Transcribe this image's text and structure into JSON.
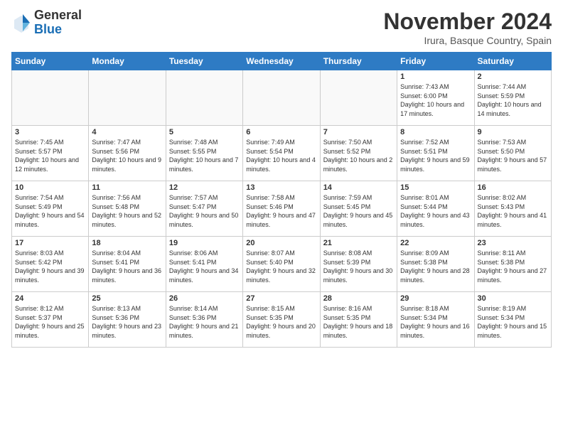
{
  "header": {
    "logo_general": "General",
    "logo_blue": "Blue",
    "month_title": "November 2024",
    "location": "Irura, Basque Country, Spain"
  },
  "days_of_week": [
    "Sunday",
    "Monday",
    "Tuesday",
    "Wednesday",
    "Thursday",
    "Friday",
    "Saturday"
  ],
  "weeks": [
    [
      {
        "day": "",
        "info": ""
      },
      {
        "day": "",
        "info": ""
      },
      {
        "day": "",
        "info": ""
      },
      {
        "day": "",
        "info": ""
      },
      {
        "day": "",
        "info": ""
      },
      {
        "day": "1",
        "info": "Sunrise: 7:43 AM\nSunset: 6:00 PM\nDaylight: 10 hours and 17 minutes."
      },
      {
        "day": "2",
        "info": "Sunrise: 7:44 AM\nSunset: 5:59 PM\nDaylight: 10 hours and 14 minutes."
      }
    ],
    [
      {
        "day": "3",
        "info": "Sunrise: 7:45 AM\nSunset: 5:57 PM\nDaylight: 10 hours and 12 minutes."
      },
      {
        "day": "4",
        "info": "Sunrise: 7:47 AM\nSunset: 5:56 PM\nDaylight: 10 hours and 9 minutes."
      },
      {
        "day": "5",
        "info": "Sunrise: 7:48 AM\nSunset: 5:55 PM\nDaylight: 10 hours and 7 minutes."
      },
      {
        "day": "6",
        "info": "Sunrise: 7:49 AM\nSunset: 5:54 PM\nDaylight: 10 hours and 4 minutes."
      },
      {
        "day": "7",
        "info": "Sunrise: 7:50 AM\nSunset: 5:52 PM\nDaylight: 10 hours and 2 minutes."
      },
      {
        "day": "8",
        "info": "Sunrise: 7:52 AM\nSunset: 5:51 PM\nDaylight: 9 hours and 59 minutes."
      },
      {
        "day": "9",
        "info": "Sunrise: 7:53 AM\nSunset: 5:50 PM\nDaylight: 9 hours and 57 minutes."
      }
    ],
    [
      {
        "day": "10",
        "info": "Sunrise: 7:54 AM\nSunset: 5:49 PM\nDaylight: 9 hours and 54 minutes."
      },
      {
        "day": "11",
        "info": "Sunrise: 7:56 AM\nSunset: 5:48 PM\nDaylight: 9 hours and 52 minutes."
      },
      {
        "day": "12",
        "info": "Sunrise: 7:57 AM\nSunset: 5:47 PM\nDaylight: 9 hours and 50 minutes."
      },
      {
        "day": "13",
        "info": "Sunrise: 7:58 AM\nSunset: 5:46 PM\nDaylight: 9 hours and 47 minutes."
      },
      {
        "day": "14",
        "info": "Sunrise: 7:59 AM\nSunset: 5:45 PM\nDaylight: 9 hours and 45 minutes."
      },
      {
        "day": "15",
        "info": "Sunrise: 8:01 AM\nSunset: 5:44 PM\nDaylight: 9 hours and 43 minutes."
      },
      {
        "day": "16",
        "info": "Sunrise: 8:02 AM\nSunset: 5:43 PM\nDaylight: 9 hours and 41 minutes."
      }
    ],
    [
      {
        "day": "17",
        "info": "Sunrise: 8:03 AM\nSunset: 5:42 PM\nDaylight: 9 hours and 39 minutes."
      },
      {
        "day": "18",
        "info": "Sunrise: 8:04 AM\nSunset: 5:41 PM\nDaylight: 9 hours and 36 minutes."
      },
      {
        "day": "19",
        "info": "Sunrise: 8:06 AM\nSunset: 5:41 PM\nDaylight: 9 hours and 34 minutes."
      },
      {
        "day": "20",
        "info": "Sunrise: 8:07 AM\nSunset: 5:40 PM\nDaylight: 9 hours and 32 minutes."
      },
      {
        "day": "21",
        "info": "Sunrise: 8:08 AM\nSunset: 5:39 PM\nDaylight: 9 hours and 30 minutes."
      },
      {
        "day": "22",
        "info": "Sunrise: 8:09 AM\nSunset: 5:38 PM\nDaylight: 9 hours and 28 minutes."
      },
      {
        "day": "23",
        "info": "Sunrise: 8:11 AM\nSunset: 5:38 PM\nDaylight: 9 hours and 27 minutes."
      }
    ],
    [
      {
        "day": "24",
        "info": "Sunrise: 8:12 AM\nSunset: 5:37 PM\nDaylight: 9 hours and 25 minutes."
      },
      {
        "day": "25",
        "info": "Sunrise: 8:13 AM\nSunset: 5:36 PM\nDaylight: 9 hours and 23 minutes."
      },
      {
        "day": "26",
        "info": "Sunrise: 8:14 AM\nSunset: 5:36 PM\nDaylight: 9 hours and 21 minutes."
      },
      {
        "day": "27",
        "info": "Sunrise: 8:15 AM\nSunset: 5:35 PM\nDaylight: 9 hours and 20 minutes."
      },
      {
        "day": "28",
        "info": "Sunrise: 8:16 AM\nSunset: 5:35 PM\nDaylight: 9 hours and 18 minutes."
      },
      {
        "day": "29",
        "info": "Sunrise: 8:18 AM\nSunset: 5:34 PM\nDaylight: 9 hours and 16 minutes."
      },
      {
        "day": "30",
        "info": "Sunrise: 8:19 AM\nSunset: 5:34 PM\nDaylight: 9 hours and 15 minutes."
      }
    ]
  ]
}
